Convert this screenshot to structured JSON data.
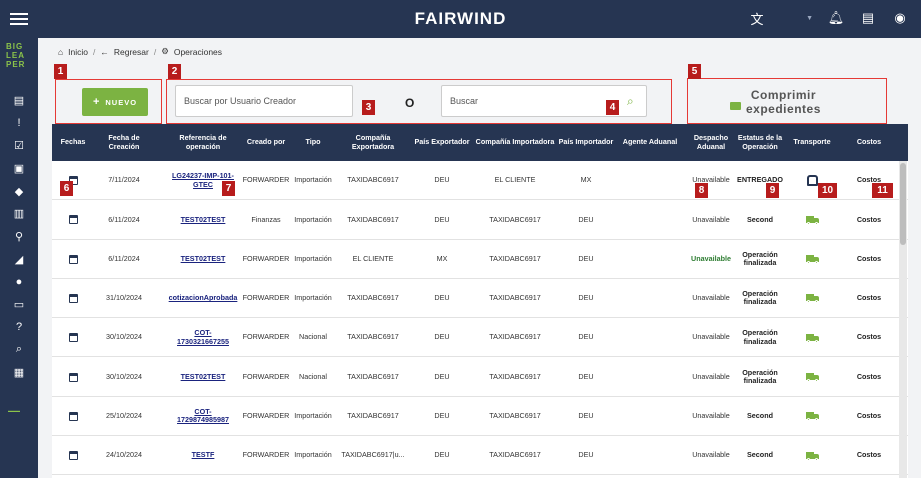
{
  "app": {
    "title": "FAIRWIND",
    "logo_text": "BIG LEA PER"
  },
  "breadcrumb": {
    "home": "Inicio",
    "back": "Regresar",
    "current": "Operaciones"
  },
  "actions": {
    "new_label": "NUEVO",
    "search_user_placeholder": "Buscar por Usuario Creador",
    "or_label": "O",
    "search_placeholder": "Buscar",
    "compress_label_1": "Comprimir",
    "compress_label_2": "expedientes"
  },
  "markers": [
    "1",
    "2",
    "3",
    "4",
    "5",
    "6",
    "7",
    "8",
    "9",
    "10",
    "11"
  ],
  "table": {
    "headers": [
      "Fechas",
      "Fecha de Creación",
      "Referencia de operación",
      "Creado por",
      "Tipo",
      "Compañía Exportadora",
      "País Exportador",
      "Compañía Importadora",
      "País Importador",
      "Agente Aduanal",
      "Despacho Aduanal",
      "Estatus de la Operación",
      "Transporte",
      "Costos"
    ],
    "rows": [
      {
        "fecha": "7/11/2024",
        "ref": "LG24237-IMP-101-GTEC",
        "creado": "FORWARDER",
        "tipo": "Importación",
        "exportadora": "TAXIDABC6917",
        "pais_exp": "DEU",
        "importadora": "EL CLIENTE",
        "pais_imp": "MX",
        "agente": "",
        "despacho": "Unavailable",
        "estatus": "ENTREGADO",
        "transporte": "ship",
        "costos": "Costos"
      },
      {
        "fecha": "6/11/2024",
        "ref": "TEST02TEST",
        "creado": "Finanzas",
        "tipo": "Importación",
        "exportadora": "TAXIDABC6917",
        "pais_exp": "DEU",
        "importadora": "TAXIDABC6917",
        "pais_imp": "DEU",
        "agente": "",
        "despacho": "Unavailable",
        "estatus": "Second",
        "transporte": "truck",
        "costos": "Costos"
      },
      {
        "fecha": "6/11/2024",
        "ref": "TEST02TEST",
        "creado": "FORWARDER",
        "tipo": "Importación",
        "exportadora": "EL CLIENTE",
        "pais_exp": "MX",
        "importadora": "TAXIDABC6917",
        "pais_imp": "DEU",
        "agente": "",
        "despacho": "Unavailable",
        "estatus": "Operación finalizada",
        "transporte": "truck",
        "costos": "Costos"
      },
      {
        "fecha": "31/10/2024",
        "ref": "cotizacionAprobada",
        "creado": "FORWARDER",
        "tipo": "Importación",
        "exportadora": "TAXIDABC6917",
        "pais_exp": "DEU",
        "importadora": "TAXIDABC6917",
        "pais_imp": "DEU",
        "agente": "",
        "despacho": "Unavailable",
        "estatus": "Operación finalizada",
        "transporte": "truck",
        "costos": "Costos"
      },
      {
        "fecha": "30/10/2024",
        "ref": "COT-1730321667255",
        "creado": "FORWARDER",
        "tipo": "Nacional",
        "exportadora": "TAXIDABC6917",
        "pais_exp": "DEU",
        "importadora": "TAXIDABC6917",
        "pais_imp": "DEU",
        "agente": "",
        "despacho": "Unavailable",
        "estatus": "Operación finalizada",
        "transporte": "truck",
        "costos": "Costos"
      },
      {
        "fecha": "30/10/2024",
        "ref": "TEST02TEST",
        "creado": "FORWARDER",
        "tipo": "Nacional",
        "exportadora": "TAXIDABC6917",
        "pais_exp": "DEU",
        "importadora": "TAXIDABC6917",
        "pais_imp": "DEU",
        "agente": "",
        "despacho": "Unavailable",
        "estatus": "Operación finalizada",
        "transporte": "truck",
        "costos": "Costos"
      },
      {
        "fecha": "25/10/2024",
        "ref": "COT-1729874985987",
        "creado": "FORWARDER",
        "tipo": "Importación",
        "exportadora": "TAXIDABC6917",
        "pais_exp": "DEU",
        "importadora": "TAXIDABC6917",
        "pais_imp": "DEU",
        "agente": "",
        "despacho": "Unavailable",
        "estatus": "Second",
        "transporte": "truck",
        "costos": "Costos"
      },
      {
        "fecha": "24/10/2024",
        "ref": "TESTF",
        "creado": "FORWARDER",
        "tipo": "Importación",
        "exportadora": "TAXIDABC6917|u...",
        "pais_exp": "DEU",
        "importadora": "TAXIDABC6917",
        "pais_imp": "DEU",
        "agente": "",
        "despacho": "Unavailable",
        "estatus": "Second",
        "transporte": "truck",
        "costos": "Costos"
      }
    ]
  },
  "colors": {
    "navy": "#263552",
    "green": "#7cb342",
    "marker": "#b71c1c",
    "box": "#e53935"
  }
}
